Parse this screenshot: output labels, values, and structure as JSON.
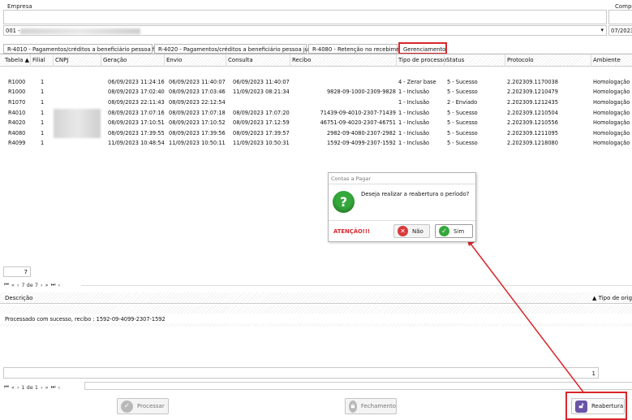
{
  "filters": {
    "empresa_label": "Empresa",
    "empresa_value": "001 -",
    "competencia_label": "Compe",
    "competencia_value": "07/2023"
  },
  "tabs": [
    {
      "label": "R-4010 - Pagamentos/créditos a beneficiário pessoa física"
    },
    {
      "label": "R-4020 - Pagamentos/créditos a beneficiário pessoa jurídica"
    },
    {
      "label": "R-4080 - Retenção no recebimento"
    },
    {
      "label": "Gerenciamento"
    }
  ],
  "table": {
    "headers": [
      "Tabela",
      "Filial",
      "CNPJ",
      "Geração",
      "Envio",
      "Consulta",
      "Recibo",
      "Tipo de processo",
      "Status",
      "Protocolo",
      "Ambiente"
    ],
    "rows": [
      [
        "R1000",
        "1",
        "",
        "06/09/2023 11:24:16",
        "06/09/2023 11:40:07",
        "06/09/2023 11:40:07",
        "",
        "4 - Zerar base",
        "5 - Sucesso",
        "2.202309.1170038",
        "Homologação"
      ],
      [
        "R1000",
        "1",
        "",
        "08/09/2023 17:02:40",
        "08/09/2023 17:03:46",
        "11/09/2023 08:21:34",
        "9828-09-1000-2309-9828",
        "1 - Inclusão",
        "5 - Sucesso",
        "2.202309.1210479",
        "Homologação"
      ],
      [
        "R1070",
        "1",
        "",
        "08/09/2023 22:11:43",
        "08/09/2023 22:12:54",
        "",
        "",
        "1 - Inclusão",
        "2 - Enviado",
        "2.202309.1212435",
        "Homologação"
      ],
      [
        "R4010",
        "1",
        "",
        "08/09/2023 17:07:16",
        "08/09/2023 17:07:18",
        "08/09/2023 17:07:20",
        "71439-09-4010-2307-71439",
        "1 - Inclusão",
        "5 - Sucesso",
        "2.202309.1210504",
        "Homologação"
      ],
      [
        "R4020",
        "1",
        "",
        "08/09/2023 17:10:51",
        "08/09/2023 17:10:52",
        "08/09/2023 17:12:59",
        "46751-09-4020-2307-46751",
        "1 - Inclusão",
        "5 - Sucesso",
        "2.202309.1210556",
        "Homologação"
      ],
      [
        "R4080",
        "1",
        "",
        "08/09/2023 17:39:55",
        "08/09/2023 17:39:56",
        "08/09/2023 17:39:57",
        "2982-09-4080-2307-2982",
        "1 - Inclusão",
        "5 - Sucesso",
        "2.202309.1211095",
        "Homologação"
      ],
      [
        "R4099",
        "1",
        "",
        "11/09/2023 10:48:54",
        "11/09/2023 10:50:11",
        "11/09/2023 10:50:31",
        "1592-09-4099-2307-1592",
        "1 - Inclusão",
        "5 - Sucesso",
        "2.202309.1218080",
        "Homologação"
      ]
    ]
  },
  "record_count": "7",
  "pager_top": "7 de 7",
  "detail": {
    "desc_header": "Descrição",
    "tipo_header": "Tipo de orige",
    "message": "Processado com sucesso, recibo : 1592-09-4099-2307-1592",
    "count": "1",
    "pager": "1 de 1"
  },
  "dialog": {
    "title": "Contas a Pagar",
    "question": "Deseja realizar a reabertura o período?",
    "warning": "ATENÇÃO!!!",
    "no_label": "Não",
    "yes_label": "Sim",
    "question_icon": "question-icon"
  },
  "actions": {
    "processar": "Processar",
    "fechamento": "Fechamento",
    "reabertura": "Reabertura"
  },
  "colors": {
    "highlight": "#d9262b",
    "green": "#35a83b",
    "red": "#d83a3a",
    "purple": "#6a55a8"
  }
}
